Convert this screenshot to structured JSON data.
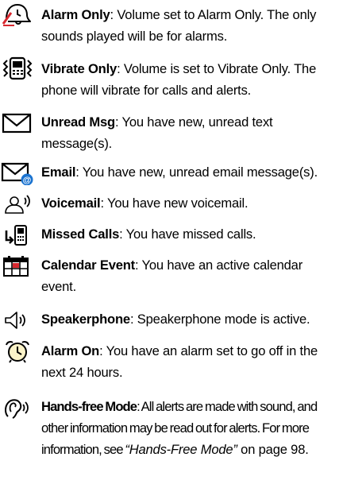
{
  "items": [
    {
      "icon": "alarm-only-icon",
      "term": "Alarm Only",
      "desc": ": Volume set to Alarm Only. The only sounds played will be for alarms."
    },
    {
      "icon": "vibrate-only-icon",
      "term": "Vibrate Only",
      "desc": ": Volume is set to Vibrate Only. The phone will vibrate for calls and alerts."
    },
    {
      "icon": "envelope-icon",
      "term": "Unread Msg",
      "desc": ": You have new, unread text message(s)."
    },
    {
      "icon": "email-icon",
      "term": "Email",
      "desc": ": You have new, unread email message(s)."
    },
    {
      "icon": "voicemail-icon",
      "term": "Voicemail",
      "desc": ": You have new voicemail."
    },
    {
      "icon": "missed-calls-icon",
      "term": "Missed Calls",
      "desc": ": You have missed calls."
    },
    {
      "icon": "calendar-icon",
      "term": "Calendar Event",
      "desc": ": You have an active calendar event."
    },
    {
      "icon": "speaker-icon",
      "term": "Speakerphone",
      "desc": ": Speakerphone mode is active."
    },
    {
      "icon": "alarm-clock-icon",
      "term": "Alarm On",
      "desc": ": You have an alarm set to go off in the next 24 hours."
    },
    {
      "icon": "hands-free-icon",
      "term": "Hands-free Mode",
      "desc": ": All alerts are made with sound, and other information may be read out for alerts. For more information, see ",
      "ref": "“Hands-Free Mode”",
      "after": " on page 98."
    }
  ],
  "colors": {
    "text": "#000000",
    "accent": "#1a73d0",
    "alarm_red": "#d7282f"
  }
}
